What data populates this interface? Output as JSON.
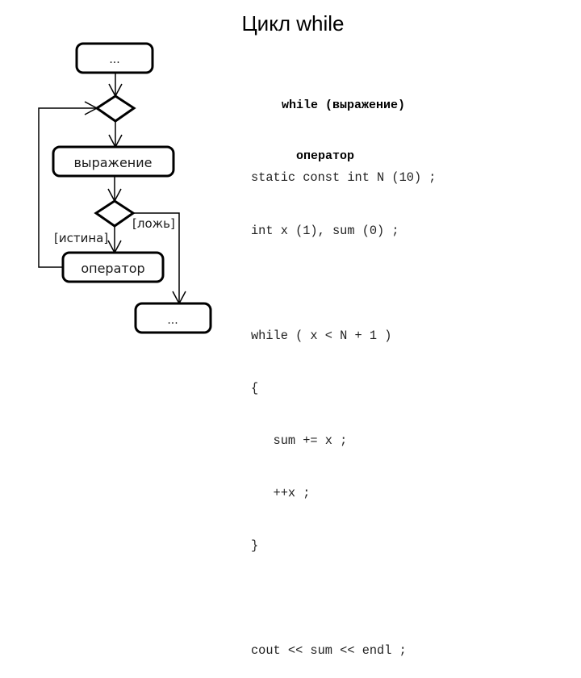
{
  "title": "Цикл while",
  "flowchart": {
    "nodes": {
      "start": "...",
      "expression": "выражение",
      "operator": "оператор",
      "end": "..."
    },
    "labels": {
      "true_branch": "[истина]",
      "false_branch": "[ложь]"
    }
  },
  "syntax": {
    "line1": "while (выражение)",
    "line2": "  оператор"
  },
  "code": {
    "lines": [
      "static const int N (10) ;",
      "int x (1), sum (0) ;",
      "",
      "while ( x < N + 1 )",
      "{",
      "   sum += x ;",
      "   ++x ;",
      "}",
      "",
      "cout << sum << endl ;"
    ]
  }
}
